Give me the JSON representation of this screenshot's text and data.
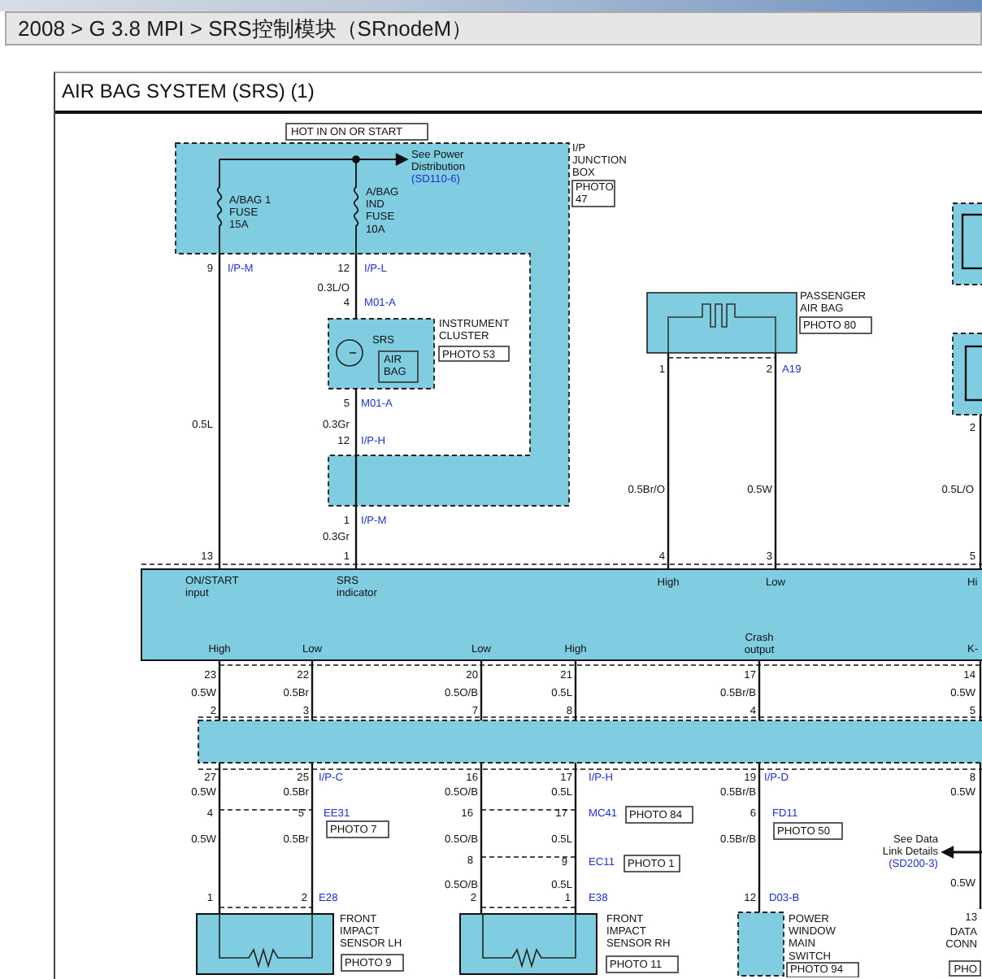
{
  "breadcrumb": "2008 > G 3.8 MPI > SRS控制模块（SRnodeM）",
  "diagram": {
    "title": "AIR BAG SYSTEM (SRS) (1)",
    "labels": [
      {
        "kind": "boxed",
        "lines": [
          "HOT IN ON OR START"
        ]
      },
      {
        "kind": "reference",
        "lines": [
          "See Power",
          "Distribution"
        ],
        "code": "(SD110-6)"
      },
      {
        "kind": "fuse",
        "lines": [
          "A/BAG 1",
          "FUSE",
          "15A"
        ]
      },
      {
        "kind": "fuse",
        "lines": [
          "A/BAG",
          "IND",
          "FUSE",
          "10A"
        ]
      },
      {
        "kind": "component",
        "lines": [
          "I/P",
          "JUNCTION",
          "BOX"
        ]
      },
      {
        "kind": "photo",
        "lines": [
          "PHOTO",
          "47"
        ]
      },
      {
        "kind": "pin",
        "lines": [
          "9"
        ]
      },
      {
        "kind": "connector",
        "lines": [
          "I/P-M"
        ]
      },
      {
        "kind": "pin",
        "lines": [
          "12"
        ]
      },
      {
        "kind": "connector",
        "lines": [
          "I/P-L"
        ]
      },
      {
        "kind": "wire",
        "lines": [
          "0.3L/O"
        ]
      },
      {
        "kind": "pin",
        "lines": [
          "4"
        ]
      },
      {
        "kind": "connector",
        "lines": [
          "M01-A"
        ]
      },
      {
        "kind": "component",
        "lines": [
          "SRS"
        ]
      },
      {
        "kind": "boxed",
        "lines": [
          "AIR",
          "BAG"
        ]
      },
      {
        "kind": "component",
        "lines": [
          "INSTRUMENT",
          "CLUSTER"
        ]
      },
      {
        "kind": "photo",
        "lines": [
          "PHOTO 53"
        ]
      },
      {
        "kind": "pin",
        "lines": [
          "5"
        ]
      },
      {
        "kind": "connector",
        "lines": [
          "M01-A"
        ]
      },
      {
        "kind": "wire",
        "lines": [
          "0.5L"
        ]
      },
      {
        "kind": "wire",
        "lines": [
          "0.3Gr"
        ]
      },
      {
        "kind": "pin",
        "lines": [
          "12"
        ]
      },
      {
        "kind": "connector",
        "lines": [
          "I/P-H"
        ]
      },
      {
        "kind": "pin",
        "lines": [
          "1"
        ]
      },
      {
        "kind": "connector",
        "lines": [
          "I/P-M"
        ]
      },
      {
        "kind": "wire",
        "lines": [
          "0.3Gr"
        ]
      },
      {
        "kind": "pin",
        "lines": [
          "13"
        ]
      },
      {
        "kind": "pin",
        "lines": [
          "1"
        ]
      },
      {
        "kind": "component",
        "lines": [
          "PASSENGER",
          "AIR BAG"
        ]
      },
      {
        "kind": "photo",
        "lines": [
          "PHOTO 80"
        ]
      },
      {
        "kind": "pin",
        "lines": [
          "1"
        ]
      },
      {
        "kind": "pin",
        "lines": [
          "2"
        ]
      },
      {
        "kind": "connector",
        "lines": [
          "A19"
        ]
      },
      {
        "kind": "pin",
        "lines": [
          "2"
        ]
      },
      {
        "kind": "wire",
        "lines": [
          "0.5Br/O"
        ]
      },
      {
        "kind": "wire",
        "lines": [
          "0.5W"
        ]
      },
      {
        "kind": "wire",
        "lines": [
          "0.5L/O"
        ]
      },
      {
        "kind": "pin",
        "lines": [
          "4"
        ]
      },
      {
        "kind": "pin",
        "lines": [
          "3"
        ]
      },
      {
        "kind": "pin",
        "lines": [
          "5"
        ]
      },
      {
        "kind": "signal",
        "lines": [
          "ON/START",
          "input"
        ]
      },
      {
        "kind": "signal",
        "lines": [
          "SRS",
          "indicator"
        ]
      },
      {
        "kind": "signal",
        "lines": [
          "High"
        ]
      },
      {
        "kind": "signal",
        "lines": [
          "Low"
        ]
      },
      {
        "kind": "signal",
        "lines": [
          "Hi"
        ]
      },
      {
        "kind": "signal",
        "lines": [
          "High"
        ]
      },
      {
        "kind": "signal",
        "lines": [
          "Low"
        ]
      },
      {
        "kind": "signal",
        "lines": [
          "Low"
        ]
      },
      {
        "kind": "signal",
        "lines": [
          "High"
        ]
      },
      {
        "kind": "signal",
        "lines": [
          "Crash",
          "output"
        ]
      },
      {
        "kind": "signal",
        "lines": [
          "K-"
        ]
      },
      {
        "kind": "pin",
        "lines": [
          "23"
        ]
      },
      {
        "kind": "pin",
        "lines": [
          "22"
        ]
      },
      {
        "kind": "pin",
        "lines": [
          "20"
        ]
      },
      {
        "kind": "pin",
        "lines": [
          "21"
        ]
      },
      {
        "kind": "pin",
        "lines": [
          "17"
        ]
      },
      {
        "kind": "pin",
        "lines": [
          "14"
        ]
      },
      {
        "kind": "wire",
        "lines": [
          "0.5W"
        ]
      },
      {
        "kind": "wire",
        "lines": [
          "0.5Br"
        ]
      },
      {
        "kind": "wire",
        "lines": [
          "0.5O/B"
        ]
      },
      {
        "kind": "wire",
        "lines": [
          "0.5L"
        ]
      },
      {
        "kind": "wire",
        "lines": [
          "0.5Br/B"
        ]
      },
      {
        "kind": "wire",
        "lines": [
          "0.5W"
        ]
      },
      {
        "kind": "pin",
        "lines": [
          "2"
        ]
      },
      {
        "kind": "pin",
        "lines": [
          "3"
        ]
      },
      {
        "kind": "pin",
        "lines": [
          "7"
        ]
      },
      {
        "kind": "pin",
        "lines": [
          "8"
        ]
      },
      {
        "kind": "pin",
        "lines": [
          "4"
        ]
      },
      {
        "kind": "pin",
        "lines": [
          "5"
        ]
      },
      {
        "kind": "pin",
        "lines": [
          "27"
        ]
      },
      {
        "kind": "pin",
        "lines": [
          "25"
        ]
      },
      {
        "kind": "connector",
        "lines": [
          "I/P-C"
        ]
      },
      {
        "kind": "wire",
        "lines": [
          "0.5W"
        ]
      },
      {
        "kind": "wire",
        "lines": [
          "0.5Br"
        ]
      },
      {
        "kind": "pin",
        "lines": [
          "4"
        ]
      },
      {
        "kind": "pin",
        "lines": [
          "5"
        ]
      },
      {
        "kind": "connector",
        "lines": [
          "EE31"
        ]
      },
      {
        "kind": "photo",
        "lines": [
          "PHOTO 7"
        ]
      },
      {
        "kind": "wire",
        "lines": [
          "0.5W"
        ]
      },
      {
        "kind": "wire",
        "lines": [
          "0.5Br"
        ]
      },
      {
        "kind": "pin",
        "lines": [
          "1"
        ]
      },
      {
        "kind": "pin",
        "lines": [
          "2"
        ]
      },
      {
        "kind": "connector",
        "lines": [
          "E28"
        ]
      },
      {
        "kind": "component",
        "lines": [
          "FRONT",
          "IMPACT",
          "SENSOR LH"
        ]
      },
      {
        "kind": "photo",
        "lines": [
          "PHOTO 9"
        ]
      },
      {
        "kind": "pin",
        "lines": [
          "16"
        ]
      },
      {
        "kind": "wire",
        "lines": [
          "0.5O/B"
        ]
      },
      {
        "kind": "pin",
        "lines": [
          "16"
        ]
      },
      {
        "kind": "wire",
        "lines": [
          "0.5O/B"
        ]
      },
      {
        "kind": "pin",
        "lines": [
          "8"
        ]
      },
      {
        "kind": "wire",
        "lines": [
          "0.5O/B"
        ]
      },
      {
        "kind": "pin",
        "lines": [
          "2"
        ]
      },
      {
        "kind": "pin",
        "lines": [
          "17"
        ]
      },
      {
        "kind": "connector",
        "lines": [
          "I/P-H"
        ]
      },
      {
        "kind": "wire",
        "lines": [
          "0.5L"
        ]
      },
      {
        "kind": "pin",
        "lines": [
          "17"
        ]
      },
      {
        "kind": "connector",
        "lines": [
          "MC41"
        ]
      },
      {
        "kind": "photo",
        "lines": [
          "PHOTO 84"
        ]
      },
      {
        "kind": "wire",
        "lines": [
          "0.5L"
        ]
      },
      {
        "kind": "pin",
        "lines": [
          "9"
        ]
      },
      {
        "kind": "connector",
        "lines": [
          "EC11"
        ]
      },
      {
        "kind": "photo",
        "lines": [
          "PHOTO 1"
        ]
      },
      {
        "kind": "wire",
        "lines": [
          "0.5L"
        ]
      },
      {
        "kind": "pin",
        "lines": [
          "1"
        ]
      },
      {
        "kind": "connector",
        "lines": [
          "E38"
        ]
      },
      {
        "kind": "component",
        "lines": [
          "FRONT",
          "IMPACT",
          "SENSOR RH"
        ]
      },
      {
        "kind": "photo",
        "lines": [
          "PHOTO 11"
        ]
      },
      {
        "kind": "pin",
        "lines": [
          "19"
        ]
      },
      {
        "kind": "connector",
        "lines": [
          "I/P-D"
        ]
      },
      {
        "kind": "wire",
        "lines": [
          "0.5Br/B"
        ]
      },
      {
        "kind": "pin",
        "lines": [
          "6"
        ]
      },
      {
        "kind": "connector",
        "lines": [
          "FD11"
        ]
      },
      {
        "kind": "photo",
        "lines": [
          "PHOTO 50"
        ]
      },
      {
        "kind": "wire",
        "lines": [
          "0.5Br/B"
        ]
      },
      {
        "kind": "pin",
        "lines": [
          "12"
        ]
      },
      {
        "kind": "connector",
        "lines": [
          "D03-B"
        ]
      },
      {
        "kind": "component",
        "lines": [
          "POWER",
          "WINDOW",
          "MAIN",
          "SWITCH"
        ]
      },
      {
        "kind": "photo",
        "lines": [
          "PHOTO 94"
        ]
      },
      {
        "kind": "reference",
        "lines": [
          "See Data",
          "Link Details"
        ],
        "code": "(SD200-3)"
      },
      {
        "kind": "pin",
        "lines": [
          "8"
        ]
      },
      {
        "kind": "wire",
        "lines": [
          "0.5W"
        ]
      },
      {
        "kind": "wire",
        "lines": [
          "0.5W"
        ]
      },
      {
        "kind": "pin",
        "lines": [
          "13"
        ]
      },
      {
        "kind": "component",
        "lines": [
          "DATA",
          "CONN"
        ]
      },
      {
        "kind": "photo",
        "lines": [
          "PHO"
        ]
      }
    ]
  }
}
